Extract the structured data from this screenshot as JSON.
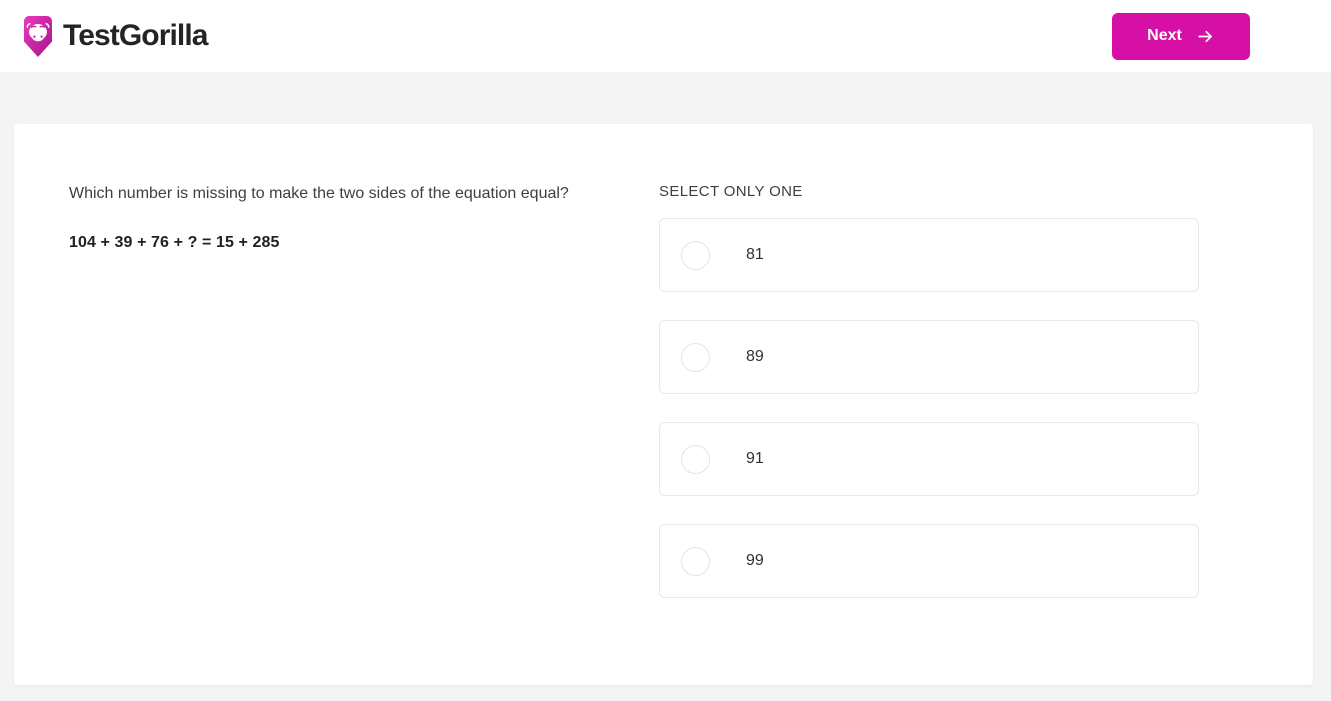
{
  "header": {
    "brand_name": "TestGorilla",
    "brand_icon": "gorilla-logo-icon",
    "brand_color": "#cf26a8",
    "next_label": "Next",
    "next_icon": "arrow-right-icon",
    "next_color": "#d610a6"
  },
  "question": {
    "prompt": "Which number is missing to make the two sides of the equation equal?",
    "equation": "104 + 39 + 76 + ? = 15 + 285"
  },
  "answers": {
    "heading": "SELECT ONLY ONE",
    "options": [
      {
        "label": "81",
        "selected": false
      },
      {
        "label": "89",
        "selected": false
      },
      {
        "label": "91",
        "selected": false
      },
      {
        "label": "99",
        "selected": false
      }
    ]
  }
}
